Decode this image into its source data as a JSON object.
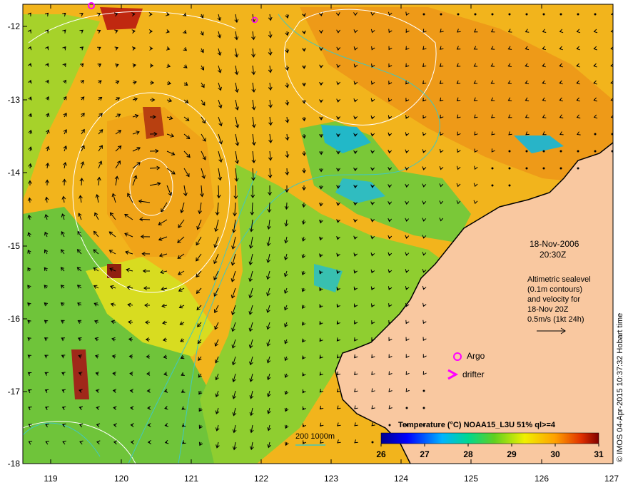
{
  "map": {
    "date": "18-Nov-2006",
    "time": "20:30Z",
    "info_lines": [
      "Altimetric sealevel",
      "(0.1m contours)",
      "and velocity for",
      "18-Nov 20Z",
      "0.5m/s (1kt 24h)"
    ],
    "legend_argo": "Argo",
    "legend_drifter": "drifter",
    "depth_label": "200  1000m",
    "colorbar_title": "Temperature (°C) NOAA15_L3U 51% ql>=4",
    "colorbar_ticks": [
      "26",
      "27",
      "28",
      "29",
      "30",
      "31"
    ],
    "side_text": "© IMOS 04-Apr-2015 10:37:32 Hobart time",
    "lat_labels": [
      "-12",
      "-13",
      "-14",
      "-15",
      "-16",
      "-17",
      "-18"
    ],
    "lon_labels": [
      "119",
      "120",
      "121",
      "122",
      "123",
      "124",
      "125",
      "126",
      "127"
    ]
  },
  "colors": {
    "land": "#f9c8a0",
    "argo": "#ff00ff",
    "drifter": "#ff00ff",
    "contour": "#ffffff",
    "isobath": "#40c8c0",
    "sst_low": "#00008f",
    "sst_high": "#800000"
  }
}
